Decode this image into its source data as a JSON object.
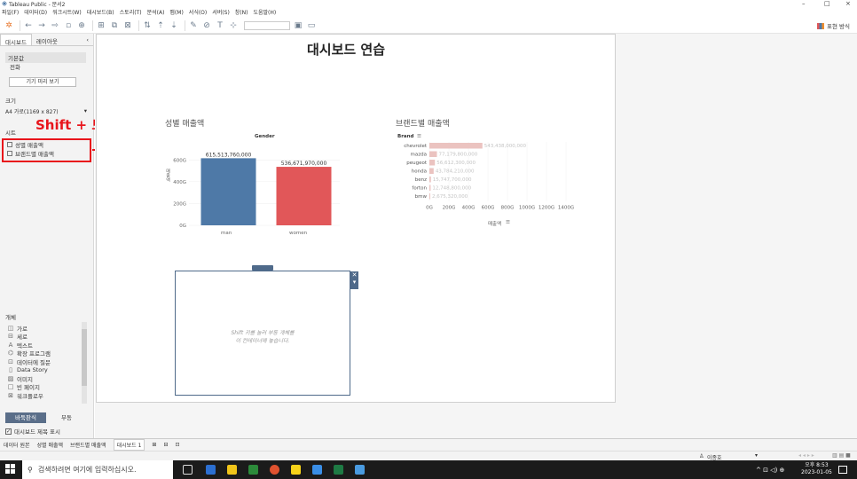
{
  "window": {
    "title": "Tableau Public - 문서2",
    "controls": [
      "–",
      "□",
      "×"
    ]
  },
  "menu": [
    "파일(F)",
    "데이터(D)",
    "워크시트(W)",
    "대시보드(B)",
    "스토리(T)",
    "분석(A)",
    "맵(M)",
    "서식(O)",
    "서버(S)",
    "창(N)",
    "도움말(H)"
  ],
  "toolbar": {
    "show_me": "표현 방식"
  },
  "left_pane": {
    "tabs": [
      "대시보드",
      "레이아웃"
    ],
    "device_preview": {
      "selected": "기본값",
      "phone": "전화",
      "button": "기기 미리 보기"
    },
    "size": {
      "label": "크기",
      "value": "A4 가로(1169 x 827)"
    },
    "sheets": {
      "label": "시트",
      "items": [
        "성별 매출액",
        "브랜드별 매출액"
      ]
    },
    "annotation": {
      "text": "Shift + 드래그"
    },
    "objects": {
      "label": "개체",
      "items": [
        {
          "icon": "horizontal-icon",
          "label": "가로"
        },
        {
          "icon": "vertical-icon",
          "label": "세로"
        },
        {
          "icon": "text-icon",
          "label": "텍스트"
        },
        {
          "icon": "extension-icon",
          "label": "확장 프로그램"
        },
        {
          "icon": "ask-data-icon",
          "label": "데이터에 질문"
        },
        {
          "icon": "data-story-icon",
          "label": "Data Story"
        },
        {
          "icon": "image-icon",
          "label": "이미지"
        },
        {
          "icon": "blank-icon",
          "label": "빈 페이지"
        },
        {
          "icon": "workflow-icon",
          "label": "워크플로우"
        }
      ],
      "toggle": [
        "바둑판식",
        "부동"
      ],
      "show_title": "대시보드 제목 표시"
    }
  },
  "dashboard": {
    "title": "대시보드 연습",
    "blank_hint_line1": "Shift 키를 눌러 부동 개체를",
    "blank_hint_line2": "이 컨테이너에 놓습니다."
  },
  "chart_data": [
    {
      "type": "bar",
      "title": "성별 매출액",
      "header": "Gender",
      "ylabel": "매출액",
      "categories": [
        "man",
        "women"
      ],
      "values": [
        615513760000,
        536671970000
      ],
      "value_labels": [
        "615,513,760,000",
        "536,671,970,000"
      ],
      "y_ticks": [
        "0G",
        "200G",
        "400G",
        "600G"
      ],
      "ylim": [
        0,
        700000000000
      ],
      "colors": [
        "#4e79a7",
        "#e15759"
      ]
    },
    {
      "type": "bar",
      "orientation": "horizontal",
      "title": "브랜드별 매출액",
      "header": "Brand",
      "xlabel": "매출액",
      "categories": [
        "chevrolet",
        "mazda",
        "peugeot",
        "honda",
        "benz",
        "forton",
        "bmw"
      ],
      "values": [
        543438000000,
        77179800000,
        56612300000,
        43784210000,
        15747700000,
        12748800000,
        2675320000
      ],
      "value_labels": [
        "543,438,000,000",
        "77,179,800,000",
        "56,612,300,000",
        "43,784,210,000",
        "15,747,700,000",
        "12,748,800,000",
        "2,675,320,000"
      ],
      "x_ticks": [
        "0G",
        "200G",
        "400G",
        "600G",
        "800G",
        "1000G",
        "1200G",
        "1400G"
      ],
      "xlim": [
        0,
        1400000000000
      ],
      "color": "#ebc3c0"
    }
  ],
  "sheet_tabs": [
    "데이터 원본",
    "성별 매출액",
    "브랜드별 매출액",
    "대시보드 1"
  ],
  "status": {
    "user": "이종호"
  },
  "taskbar": {
    "search_placeholder": "검색하려면 여기에 입력하십시오.",
    "time": "오후 8:53",
    "date": "2023-01-05"
  }
}
